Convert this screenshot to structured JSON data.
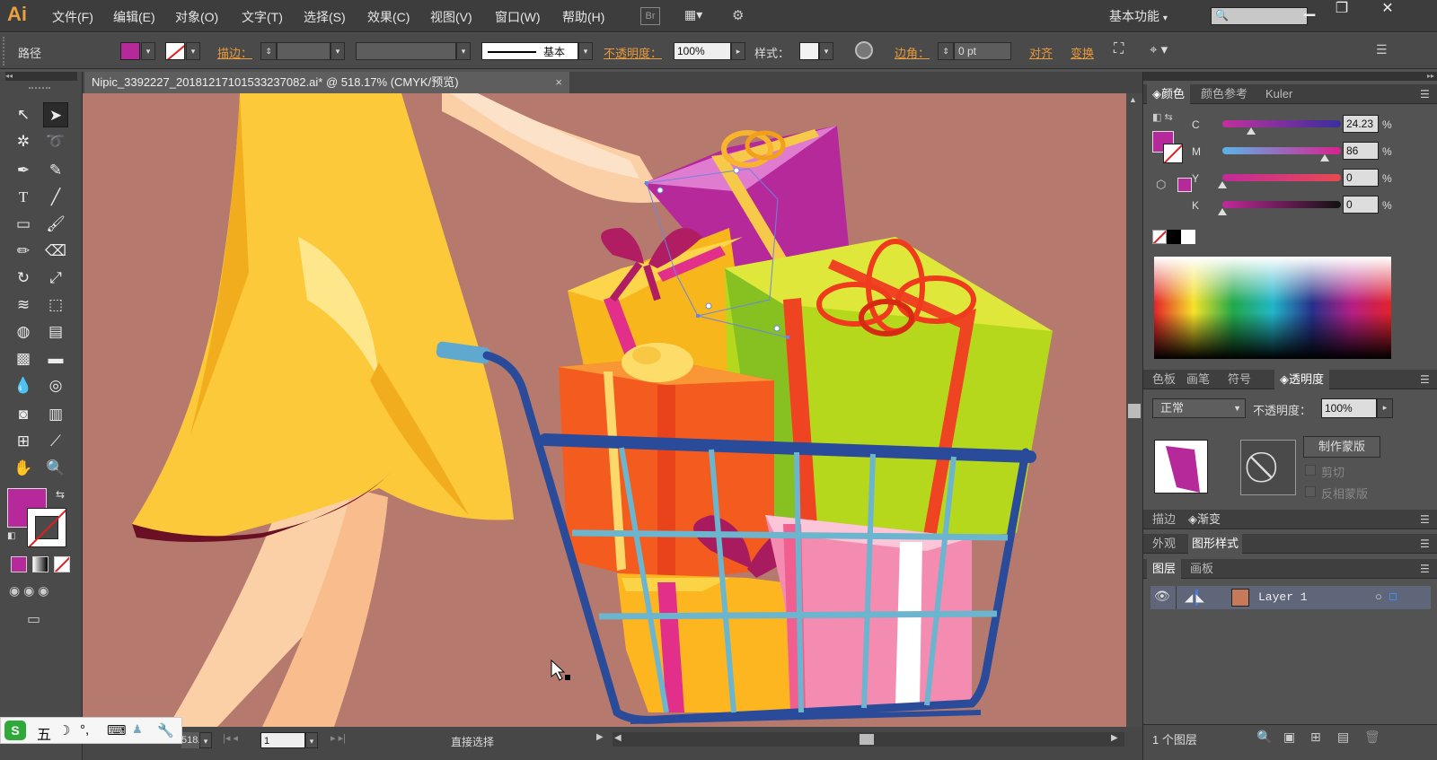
{
  "app": {
    "logo": "Ai"
  },
  "menu": [
    "文件(F)",
    "编辑(E)",
    "对象(O)",
    "文字(T)",
    "选择(S)",
    "效果(C)",
    "视图(V)",
    "窗口(W)",
    "帮助(H)"
  ],
  "menu_bridge": "Br",
  "workspace": "基本功能",
  "control": {
    "selection_label": "路径",
    "stroke_label": "描边：",
    "stroke_style": "基本",
    "opacity_label": "不透明度：",
    "opacity_value": "100%",
    "style_label": "样式：",
    "corner_label": "边角：",
    "corner_value": "0 pt",
    "align_label": "对齐",
    "transform_label": "变换"
  },
  "document": {
    "tab_title": "Nipic_3392227_20181217101533237082.ai* @ 518.17% (CMYK/预览)",
    "close": "×"
  },
  "status": {
    "zoom": "518.17",
    "page": "1",
    "tool": "直接选择"
  },
  "color_panel": {
    "tabs": [
      "颜色",
      "颜色参考",
      "Kuler"
    ],
    "channels": [
      {
        "label": "C",
        "value": "24.23",
        "unit": "%",
        "level": 0.2423
      },
      {
        "label": "M",
        "value": "86",
        "unit": "%",
        "level": 0.86
      },
      {
        "label": "Y",
        "value": "0",
        "unit": "%",
        "level": 0
      },
      {
        "label": "K",
        "value": "0",
        "unit": "%",
        "level": 0
      }
    ],
    "fill_color": "#b5299b"
  },
  "transparency_panel": {
    "tabs": [
      "色板",
      "画笔",
      "符号",
      "透明度"
    ],
    "blend_mode": "正常",
    "opacity_label": "不透明度：",
    "opacity_value": "100%",
    "make_mask": "制作蒙版",
    "clip": "剪切",
    "invert_mask": "反相蒙版"
  },
  "stroke_gradient_tabs": [
    "描边",
    "渐变"
  ],
  "appearance_tabs": [
    "外观",
    "图形样式"
  ],
  "layers_panel": {
    "tabs": [
      "图层",
      "画板"
    ],
    "layers": [
      {
        "name": "Layer 1"
      }
    ],
    "footer": "1 个图层"
  },
  "ime": {
    "label": "五"
  }
}
